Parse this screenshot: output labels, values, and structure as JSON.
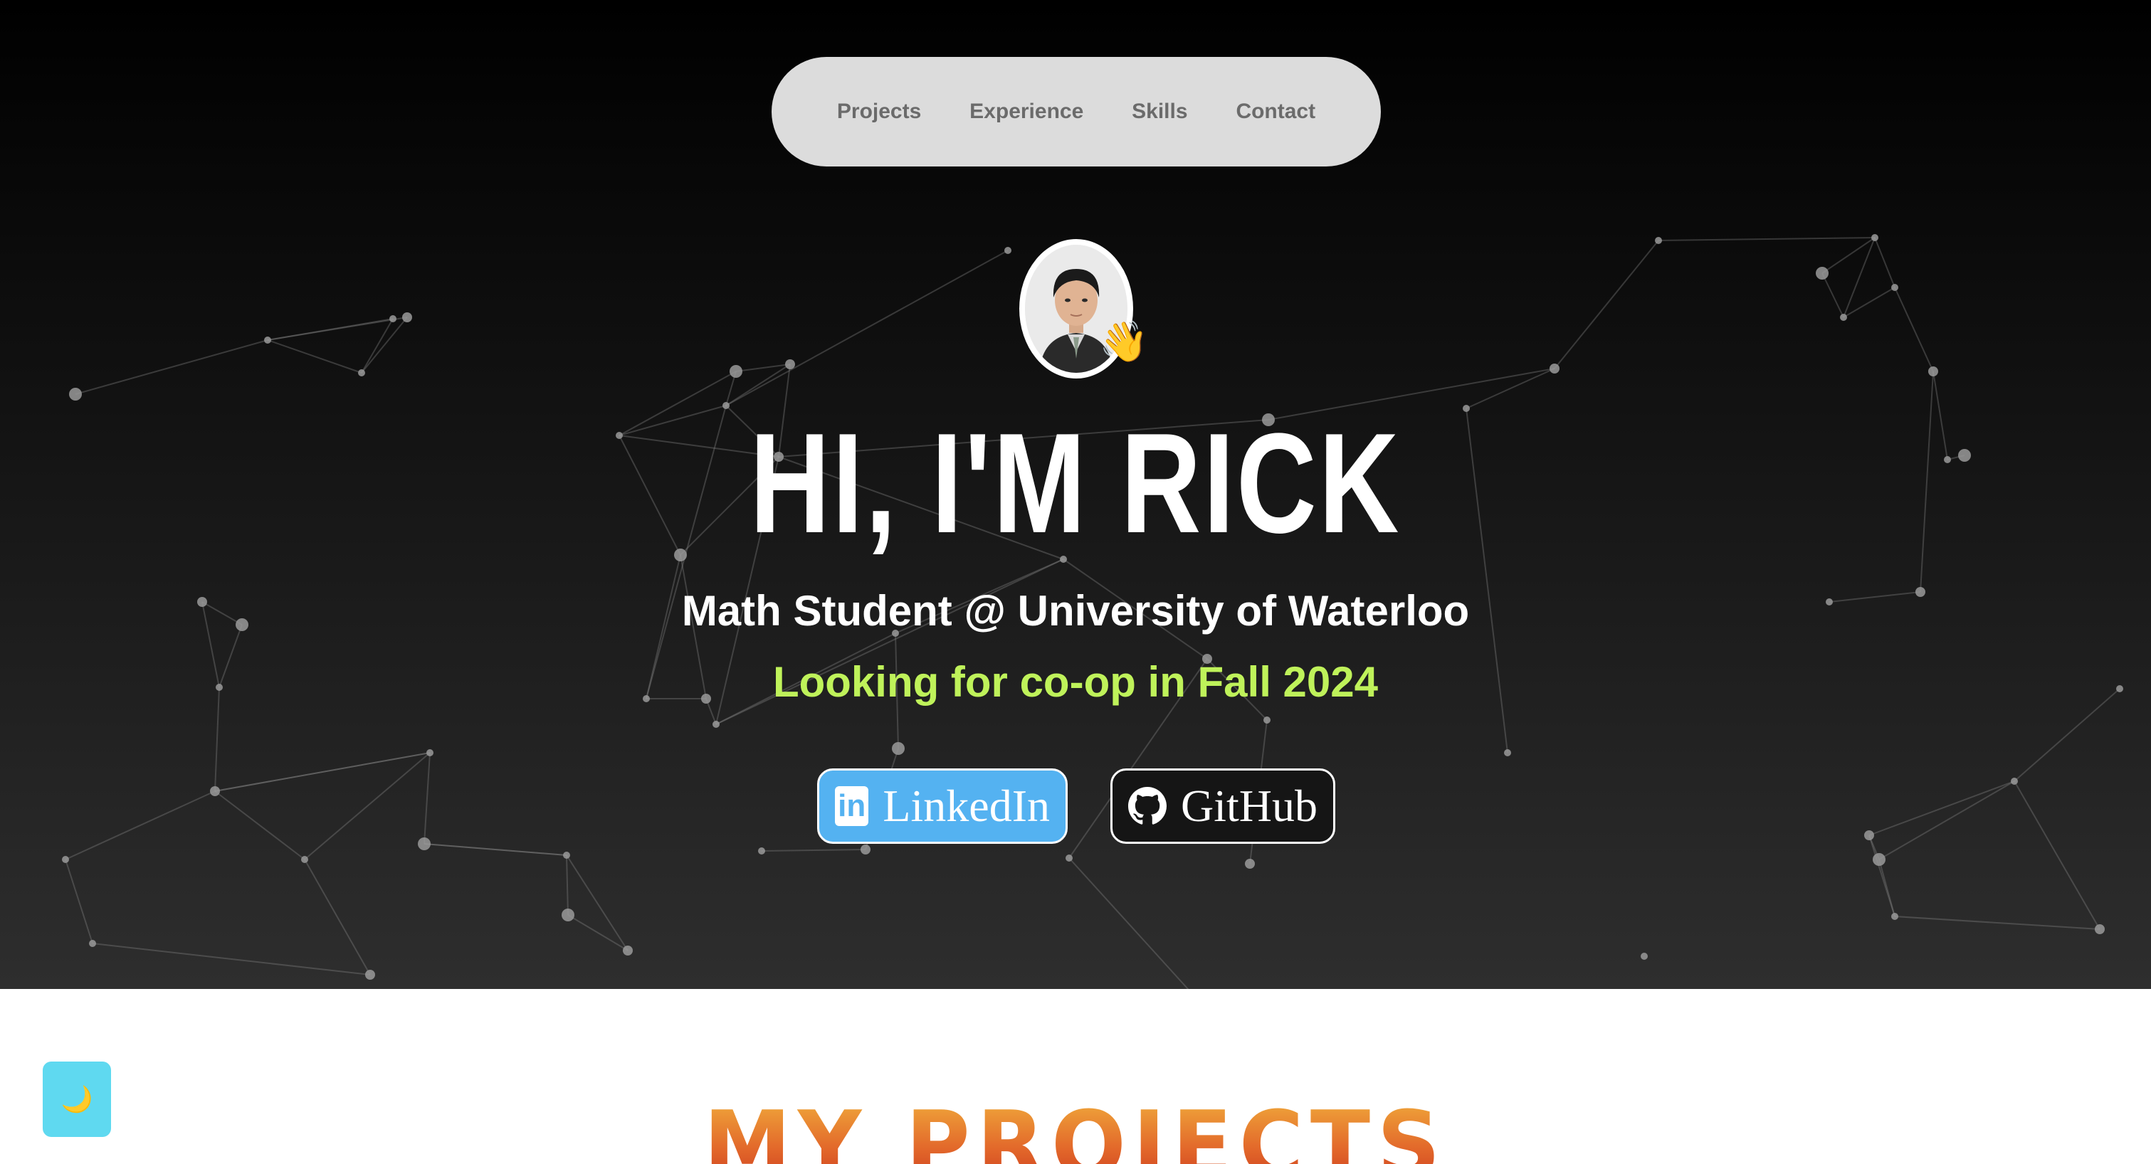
{
  "nav": {
    "items": [
      {
        "label": "Projects"
      },
      {
        "label": "Experience"
      },
      {
        "label": "Skills"
      },
      {
        "label": "Contact"
      }
    ]
  },
  "hero": {
    "avatar_icon": "waving-hand-icon",
    "title": "HI, I'M RICK",
    "subtitle": "Math Student @ University of Waterloo",
    "status": "Looking for co-op in Fall 2024",
    "status_color": "#bff25a"
  },
  "social": {
    "linkedin": {
      "label": "LinkedIn",
      "icon": "linkedin-icon",
      "color": "#54b2f1"
    },
    "github": {
      "label": "GitHub",
      "icon": "github-icon"
    }
  },
  "theme_toggle": {
    "icon": "moon-icon",
    "color": "#5fd9f0"
  },
  "projects": {
    "heading": "MY PROJECTS"
  }
}
